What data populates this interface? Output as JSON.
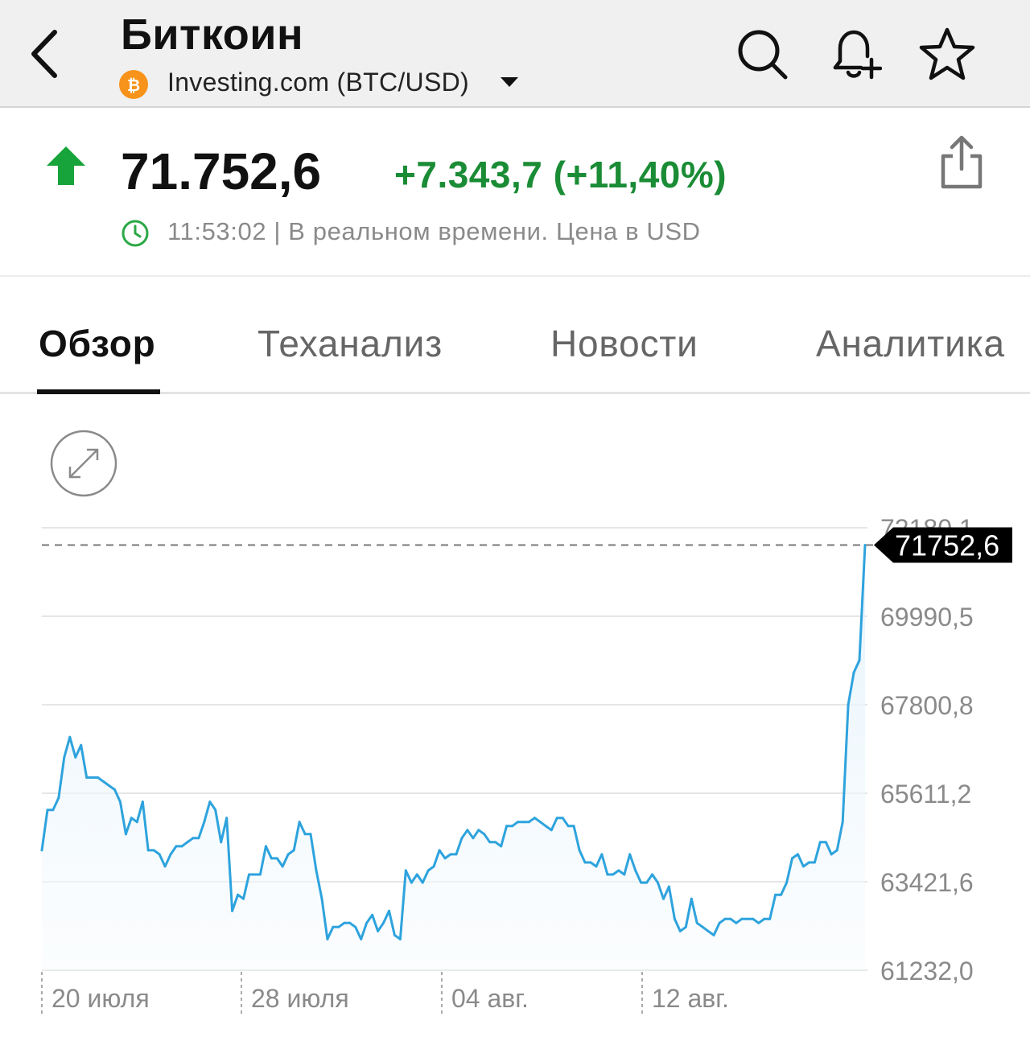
{
  "header": {
    "title": "Биткоин",
    "source": "Investing.com (BTC/USD)",
    "icons": [
      "back-chevron-icon",
      "bitcoin-icon",
      "dropdown-caret-icon",
      "search-icon",
      "bell-add-icon",
      "star-icon"
    ]
  },
  "quote": {
    "price": "71.752,6",
    "change": "+7.343,7 (+11,40%)",
    "time": "11:53:02 | В реальном времени. Цена в USD",
    "direction": "up",
    "colors": {
      "up": "#1a8c35",
      "arrow": "#17a43a"
    }
  },
  "tabs": [
    "Обзор",
    "Теханализ",
    "Новости",
    "Аналитика"
  ],
  "chart_data": {
    "type": "area",
    "y_ticks": [
      "72180,1",
      "69990,5",
      "67800,8",
      "65611,2",
      "63421,6",
      "61232,0"
    ],
    "ylim": [
      61232.0,
      72180.1
    ],
    "x_labels": [
      "20 июля",
      "28 июля",
      "04 авг.",
      "12 авг."
    ],
    "last_price_label": "71752,6",
    "last_value": 71752.6,
    "line_color": "#2ea3dd",
    "grid": true,
    "values": [
      64200,
      65200,
      65200,
      65500,
      66500,
      67000,
      66500,
      66800,
      66000,
      66000,
      66000,
      65900,
      65800,
      65700,
      65400,
      64600,
      65000,
      64900,
      65400,
      64200,
      64200,
      64100,
      63800,
      64100,
      64300,
      64300,
      64400,
      64500,
      64500,
      64900,
      65400,
      65200,
      64400,
      65000,
      62700,
      63100,
      63000,
      63600,
      63600,
      63600,
      64300,
      64000,
      64000,
      63800,
      64100,
      64200,
      64900,
      64600,
      64600,
      63700,
      63000,
      62000,
      62300,
      62300,
      62400,
      62400,
      62300,
      62000,
      62400,
      62600,
      62200,
      62400,
      62700,
      62100,
      62000,
      63700,
      63400,
      63600,
      63400,
      63700,
      63800,
      64200,
      64000,
      64100,
      64100,
      64500,
      64700,
      64500,
      64700,
      64600,
      64400,
      64400,
      64300,
      64800,
      64800,
      64900,
      64900,
      64900,
      65000,
      64900,
      64800,
      64700,
      65000,
      65000,
      64800,
      64800,
      64200,
      63900,
      63900,
      63800,
      64100,
      63600,
      63600,
      63700,
      63600,
      64100,
      63700,
      63400,
      63400,
      63600,
      63400,
      63000,
      63300,
      62500,
      62200,
      62300,
      63000,
      62400,
      62300,
      62200,
      62100,
      62400,
      62500,
      62500,
      62400,
      62500,
      62500,
      62500,
      62400,
      62500,
      62500,
      63100,
      63100,
      63400,
      64000,
      64100,
      63800,
      63900,
      63900,
      64400,
      64400,
      64100,
      64200,
      64900,
      67800,
      68600,
      68900,
      71752.6
    ]
  }
}
